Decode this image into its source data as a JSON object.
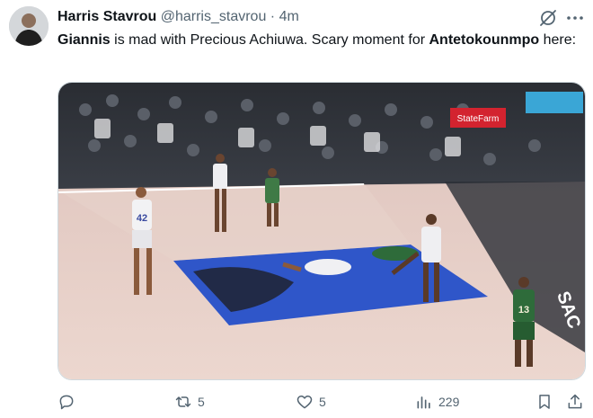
{
  "tweet": {
    "author_name": "Harris Stavrou",
    "handle": "@harris_stavrou",
    "separator": "·",
    "time": "4m",
    "text_parts": {
      "bold1": "Giannis",
      "part1": " is mad with Precious Achiuwa. Scary moment for ",
      "bold2": "Antetokounmpo",
      "part2": " here:"
    }
  },
  "media": {
    "signage": {
      "sponsor_banner": "StateFarm",
      "corner_text": "SAC",
      "jersey_white": "42",
      "jersey_green": "13"
    }
  },
  "actions": {
    "reply_count": "",
    "retweet_count": "5",
    "like_count": "5",
    "views_count": "229"
  },
  "icons": [
    "reply-icon",
    "retweet-icon",
    "like-icon",
    "views-icon",
    "bookmark-icon",
    "share-icon",
    "grok-icon",
    "more-icon"
  ]
}
